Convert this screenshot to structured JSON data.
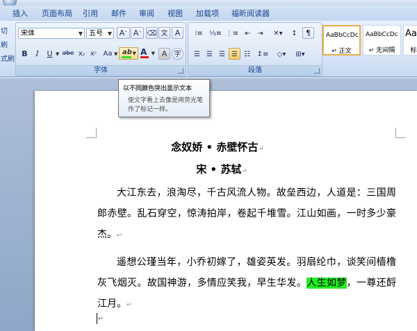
{
  "tabs": [
    "插入",
    "页面布局",
    "引用",
    "邮件",
    "审阅",
    "视图",
    "加载项",
    "福昕阅读器"
  ],
  "left_clip": {
    "items": [
      "切",
      "刷",
      "式刷"
    ]
  },
  "font_group": {
    "font_name": "宋体",
    "font_size": "五号",
    "label": "字体"
  },
  "paragraph_group": {
    "label": "段落"
  },
  "styles": [
    {
      "sample": "AaBbCcDc",
      "name": "↵ 正文"
    },
    {
      "sample": "AaBbCcDc",
      "name": "↵ 无间隔"
    },
    {
      "sample": "AaB",
      "name": "标"
    }
  ],
  "tooltip": {
    "title": "以不同颜色突出显示文本",
    "body": "使文字看上去像是用荧光笔作了标记一样。"
  },
  "document": {
    "title": "念奴娇 • 赤壁怀古",
    "author": "宋 • 苏轼",
    "para1": "大江东去，浪淘尽，千古风流人物。故垒西边，人道是：三国周郎赤壁。乱石穿空，惊涛拍岸，卷起千堆雪。江山如画，一时多少豪杰。",
    "para2_before": "遥想公瑾当年，小乔初嫁了，雄姿英发。羽扇纶巾，谈笑间樯橹灰飞烟灭。故国神游，多情应笑我，早生华发。",
    "para2_highlight": "人生如梦",
    "para2_after": "，一尊还酹江月。",
    "para_mark": "↵",
    "highlight_color": "#22ee22"
  },
  "colors": {
    "ribbon_text": "#15428b",
    "font_color_bar": "#e02020",
    "highlight_bar": "#33dd33"
  }
}
